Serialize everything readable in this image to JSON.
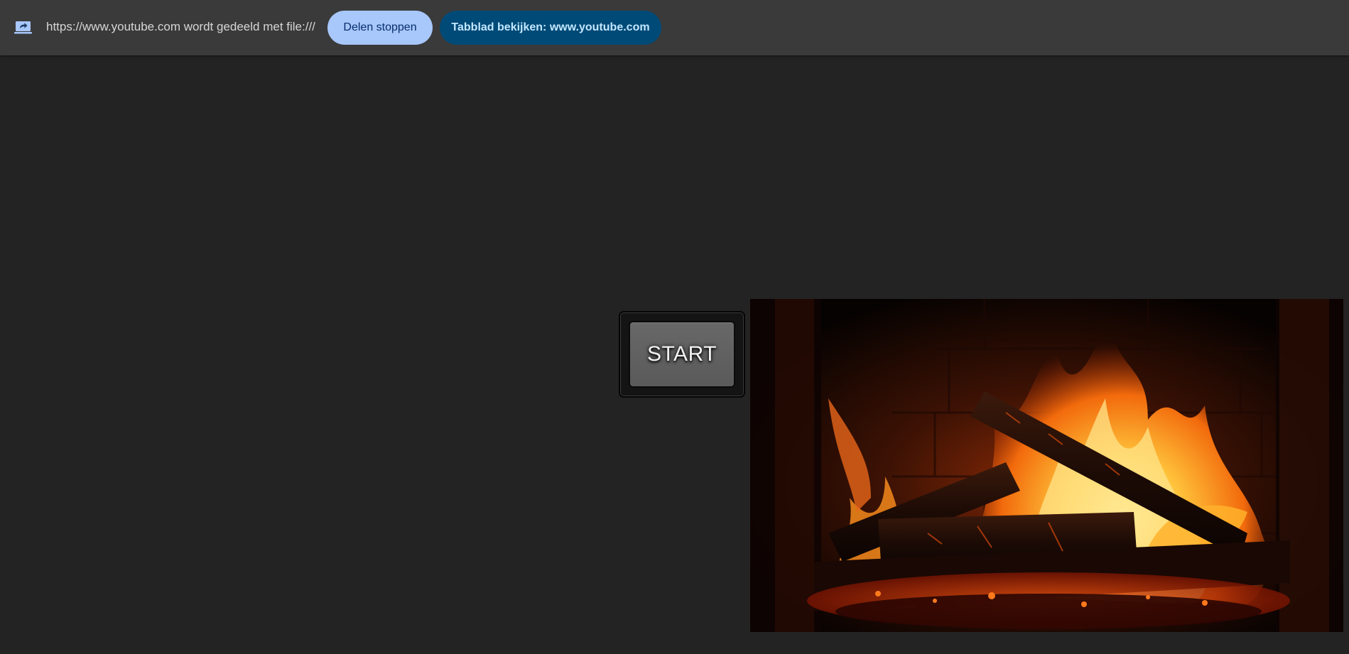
{
  "share_bar": {
    "icon": "screen-share-icon",
    "message": "https://www.youtube.com wordt gedeeld met file:///",
    "stop_label": "Delen stoppen",
    "view_tab_label": "Tabblad bekijken: www.youtube.com"
  },
  "main": {
    "start_label": "START",
    "video": {
      "icon": "fireplace-video",
      "description_visible": false
    }
  },
  "colors": {
    "bar_background": "#3a3a3a",
    "page_background": "#232323",
    "stop_button": "#a8c7fa",
    "view_tab_button": "#004a77"
  }
}
